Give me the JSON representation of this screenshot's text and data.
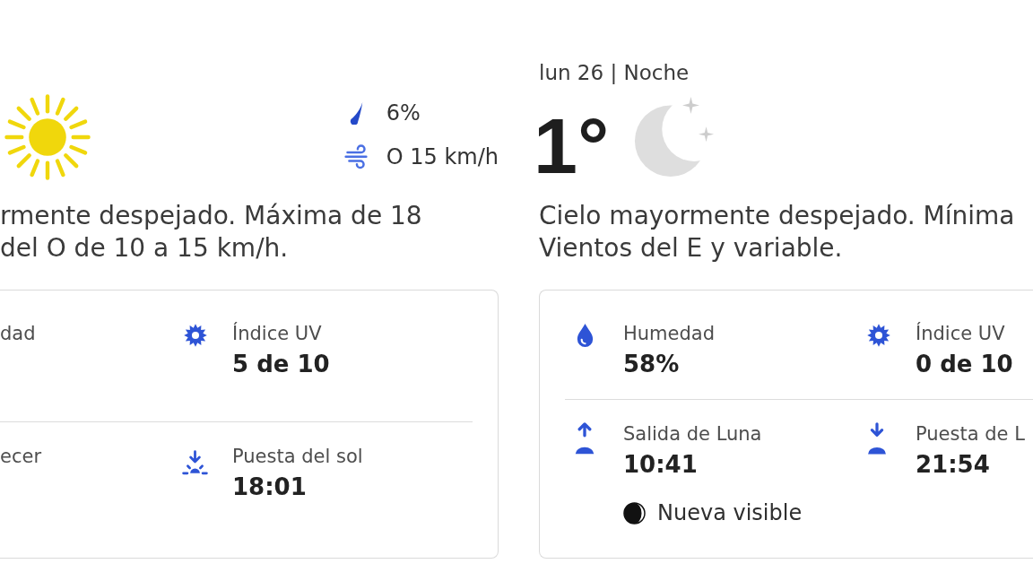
{
  "panels": [
    {
      "kind": "day",
      "precipitation": "6%",
      "wind": "O 15 km/h",
      "description": [
        "rmente despejado. Máxima de 18",
        "del O de 10 a 15 km/h."
      ],
      "details": [
        {
          "label": "dad"
        },
        {
          "kind": "uv",
          "label": "Índice UV",
          "value": "5 de 10"
        },
        {
          "label": "ecer"
        },
        {
          "kind": "sunset",
          "label": "Puesta del sol",
          "value": "18:01"
        }
      ]
    },
    {
      "kind": "night",
      "header": "lun 26 | Noche",
      "temperature": "1°",
      "description": [
        "Cielo mayormente despejado. Mínima",
        "Vientos del E y variable."
      ],
      "details": [
        {
          "kind": "humidity",
          "label": "Humedad",
          "value": "58%"
        },
        {
          "kind": "uv",
          "label": "Índice UV",
          "value": "0 de 10"
        },
        {
          "kind": "moonrise",
          "label": "Salida de Luna",
          "value": "10:41",
          "moon_phase": "Nueva visible"
        },
        {
          "kind": "moonset",
          "label": "Puesta de L",
          "value": "21:54"
        }
      ]
    }
  ]
}
